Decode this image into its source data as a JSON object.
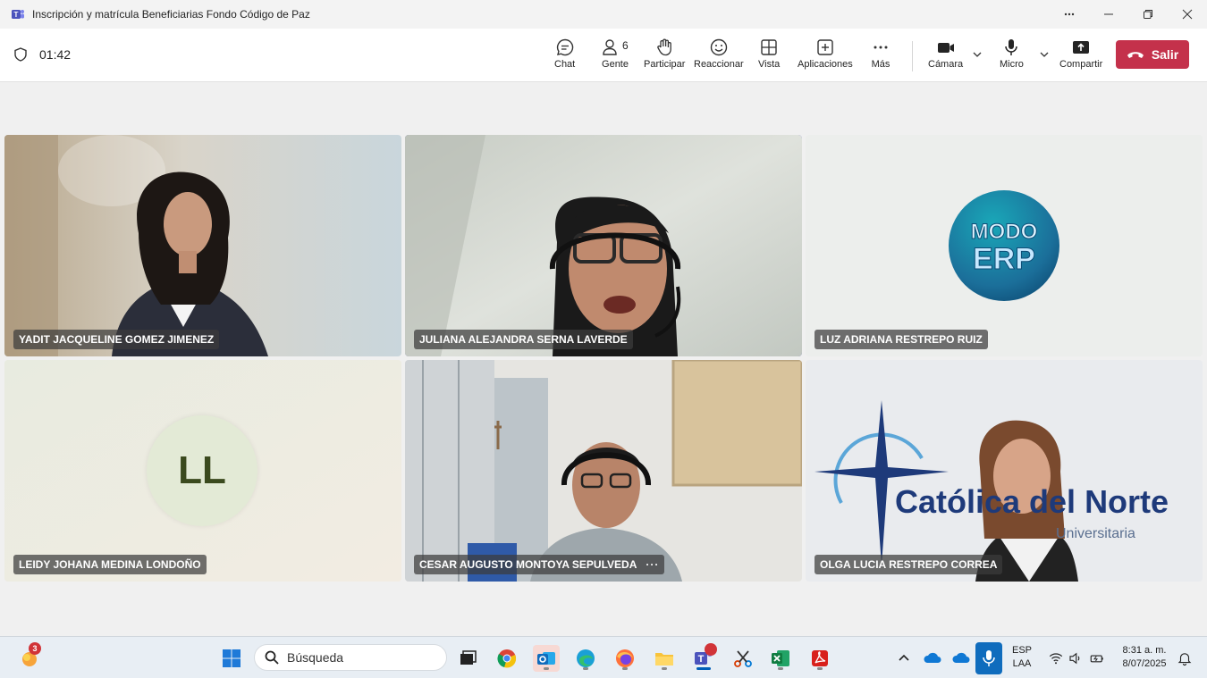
{
  "window": {
    "title": "Inscripción y matrícula Beneficiarias Fondo Código de Paz",
    "more_icon": "more-horizontal-icon"
  },
  "meeting": {
    "timer": "01:42",
    "toolbar": {
      "chat": "Chat",
      "people": "Gente",
      "people_count": "6",
      "raise": "Participar",
      "react": "Reaccionar",
      "view": "Vista",
      "apps": "Aplicaciones",
      "more": "Más",
      "camera": "Cámara",
      "mic": "Micro",
      "share": "Compartir",
      "leave": "Salir"
    },
    "participants": [
      {
        "name": "YADIT JACQUELINE GOMEZ JIMENEZ",
        "type": "video"
      },
      {
        "name": "JULIANA ALEJANDRA SERNA LAVERDE",
        "type": "video",
        "active_speaker": true
      },
      {
        "name": "LUZ ADRIANA RESTREPO RUIZ",
        "type": "logo",
        "logo_text_top": "MODO",
        "logo_text_bottom": "ERP"
      },
      {
        "name": "LEIDY JOHANA MEDINA LONDOÑO",
        "type": "avatar",
        "initials": "LL"
      },
      {
        "name": "CESAR AUGUSTO MONTOYA SEPULVEDA",
        "type": "video",
        "more": "···"
      },
      {
        "name": "OLGA LUCIA RESTREPO CORREA",
        "type": "video",
        "background_text": "Católica del Norte",
        "background_subtext": "Universitaria"
      }
    ]
  },
  "taskbar": {
    "search_placeholder": "Búsqueda",
    "weather_badge": "3",
    "language_line1": "ESP",
    "language_line2": "LAA",
    "time": "8:31 a. m.",
    "date": "8/07/2025"
  },
  "colors": {
    "accent": "#5b5fc7",
    "leave": "#c4314b",
    "teams": "#4b53bc"
  }
}
